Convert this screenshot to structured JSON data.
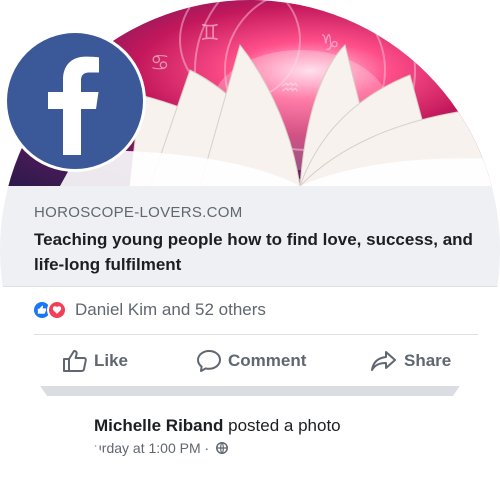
{
  "link_preview": {
    "domain": "HOROSCOPE-LOVERS.COM",
    "headline": "Teaching young people how to find love, success, and life-long fulfilment"
  },
  "reactions": {
    "text": "Daniel Kim and 52 others",
    "types": [
      "like",
      "love"
    ]
  },
  "actions": {
    "like": "Like",
    "comment": "Comment",
    "share": "Share"
  },
  "next_post": {
    "author": "Michelle Riband",
    "action": " posted a photo",
    "timestamp": "urday at 1:00 PM ·"
  },
  "icons": {
    "logo": "facebook-logo-icon",
    "like": "thumbs-up-icon",
    "comment": "speech-bubble-icon",
    "share": "share-arrow-icon",
    "privacy": "globe-icon"
  },
  "colors": {
    "facebook_blue": "#3b5998",
    "like_blue": "#1877f2",
    "love_red": "#f33e58",
    "text_primary": "#1c1e21",
    "text_secondary": "#606770"
  }
}
